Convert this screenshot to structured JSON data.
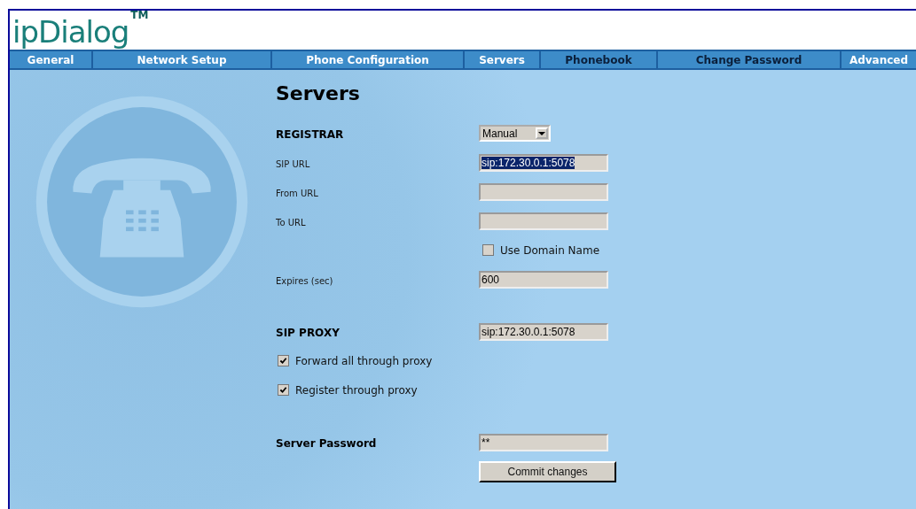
{
  "logo": {
    "name": "ipDialog",
    "mark": "TM"
  },
  "tabs": [
    {
      "label": "General",
      "visited": false
    },
    {
      "label": "Network Setup",
      "visited": false
    },
    {
      "label": "Phone Configuration",
      "visited": false
    },
    {
      "label": "Servers",
      "visited": false
    },
    {
      "label": "Phonebook",
      "visited": true
    },
    {
      "label": "Change Password",
      "visited": true
    },
    {
      "label": "Advanced",
      "visited": false
    }
  ],
  "page_title": "Servers",
  "sections": [
    {
      "rows": [
        {
          "kind": "select",
          "label": "REGISTRAR",
          "heading": true,
          "value": "Manual"
        },
        {
          "kind": "field",
          "label": "SIP URL",
          "heading": false,
          "value": "sip:172.30.0.1:5078",
          "highlighted": true
        },
        {
          "kind": "field",
          "label": "From URL",
          "heading": false
        },
        {
          "kind": "field",
          "label": "To URL",
          "heading": false
        },
        {
          "kind": "value_check",
          "label": "Use Domain Name",
          "checked": false
        },
        {
          "kind": "field",
          "label": "Expires (sec)",
          "heading": false,
          "value": "600",
          "highlighted": false
        }
      ]
    },
    {
      "rows": [
        {
          "kind": "field",
          "label": "SIP PROXY",
          "heading": true,
          "value": "sip:172.30.0.1:5078",
          "highlighted": false
        },
        {
          "kind": "check",
          "label": "Forward all through proxy",
          "checked": true
        },
        {
          "kind": "check",
          "label": "Register through proxy",
          "checked": true
        }
      ]
    },
    {
      "rows": [
        {
          "kind": "field",
          "label": "Server Password",
          "heading": true,
          "value": "**",
          "highlighted": false
        },
        {
          "kind": "button",
          "label": "Commit changes"
        }
      ]
    }
  ]
}
